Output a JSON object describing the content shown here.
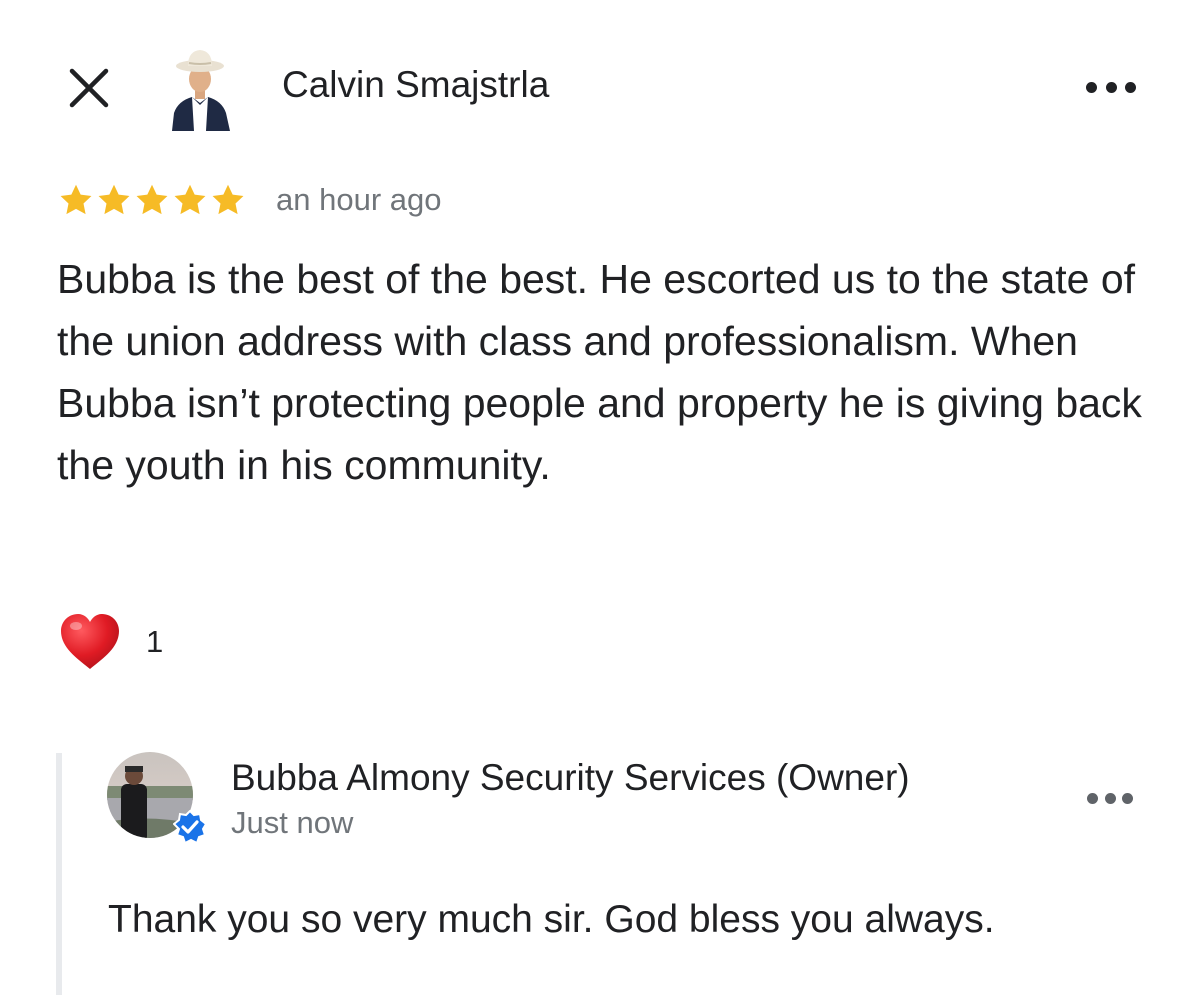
{
  "review": {
    "reviewer_name": "Calvin Smajstrla",
    "rating": 5,
    "rating_max": 5,
    "time_ago": "an hour ago",
    "text": "Bubba is the best of the best. He escorted us to the state of the union address with class and professionalism. When Bubba isn’t protecting people and property he is giving back the youth in his community.",
    "reaction_icon": "heart-icon",
    "reaction_count": "1"
  },
  "owner_reply": {
    "name": "Bubba Almony Security Services (Owner)",
    "time": "Just now",
    "text": "Thank you so very much sir. God bless you always.",
    "verified_icon": "verified-badge-icon"
  },
  "icons": {
    "close": "close-icon",
    "more": "more-horizontal-icon"
  },
  "colors": {
    "star": "#f6bb26",
    "heart": "#e01b24",
    "verified": "#1a73e8",
    "secondary_text": "#70757a",
    "reply_bar": "#e8eaed"
  }
}
